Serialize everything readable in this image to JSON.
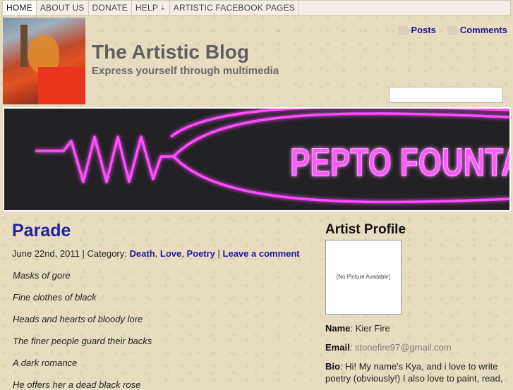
{
  "nav": {
    "items": [
      "HOME",
      "ABOUT US",
      "DONATE",
      "HELP",
      "ARTISTIC FACEBOOK PAGES"
    ]
  },
  "header": {
    "title": "The Artistic Blog",
    "tagline": "Express yourself through multimedia",
    "feeds": {
      "posts": "Posts",
      "comments": "Comments"
    }
  },
  "banner": {
    "text": "PEPTO FOUNTA"
  },
  "post": {
    "title": "Parade",
    "date": "June 22nd, 2011",
    "category_label": "Category:",
    "categories": [
      "Death",
      "Love",
      "Poetry"
    ],
    "comment_link": "Leave a comment",
    "lines": [
      "Masks of gore",
      "Fine clothes of black",
      "Heads and hearts of bloody lore",
      "The finer people guard their backs",
      "A dark romance",
      "He offers her a dead black rose"
    ]
  },
  "sidebar": {
    "title": "Artist Profile",
    "avatar_text": "[No Picture Available]",
    "name_label": "Name",
    "name_value": "Kier Fire",
    "email_label": "Email",
    "email_value": "stonefire97@gmail.com",
    "bio_label": "Bio",
    "bio_value": "Hi! My name's Kya, and i love to write poetry (obviously!) I also love to paint, read,"
  },
  "colors": {
    "link": "#1b1b9a",
    "neon": "#ff33ff",
    "background": "#e8dcc0"
  }
}
